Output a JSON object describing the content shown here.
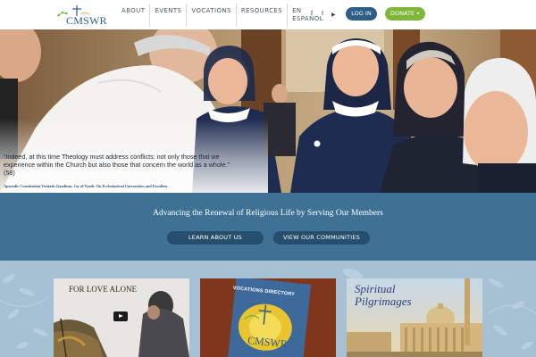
{
  "header": {
    "logo_text": "CMSWR",
    "nav": [
      {
        "label": "ABOUT"
      },
      {
        "label": "EVENTS"
      },
      {
        "label": "VOCATIONS"
      },
      {
        "label": "RESOURCES"
      }
    ],
    "lang_line1": "EN",
    "lang_line2": "ESPAÑOL",
    "social": {
      "facebook": "f",
      "twitter": "t",
      "youtube": "▶"
    },
    "login_label": "LOG IN",
    "donate_label": "DONATE"
  },
  "hero": {
    "quote": "“Indeed, at this time Theology must address conflicts: not only those that we experience within the Church but also those that concern the world as a whole.” (58)",
    "citation": "Apostolic Constitution Veritatis Gaudium,  Joy of Truth: On Ecclesiastical Universities and Faculties."
  },
  "band": {
    "tagline": "Advancing the Renewal of Religious Life by Serving Our Members",
    "learn_label": "LEARN ABOUT US",
    "communities_label": "VIEW OUR COMMUNITIES"
  },
  "cards": {
    "card1_title": "FOR LOVE ALONE",
    "card2_title": "VOCATIONS DIRECTORY",
    "card2_logo": "CMSWR",
    "card3_title_line1": "Spiritual",
    "card3_title_line2": "Pilgrimages"
  },
  "colors": {
    "brand_blue": "#2e5d86",
    "donate_green": "#7fb73b",
    "band": "#3e7194",
    "band_button": "#264e6d",
    "lower_bg": "#a6c1d4"
  }
}
